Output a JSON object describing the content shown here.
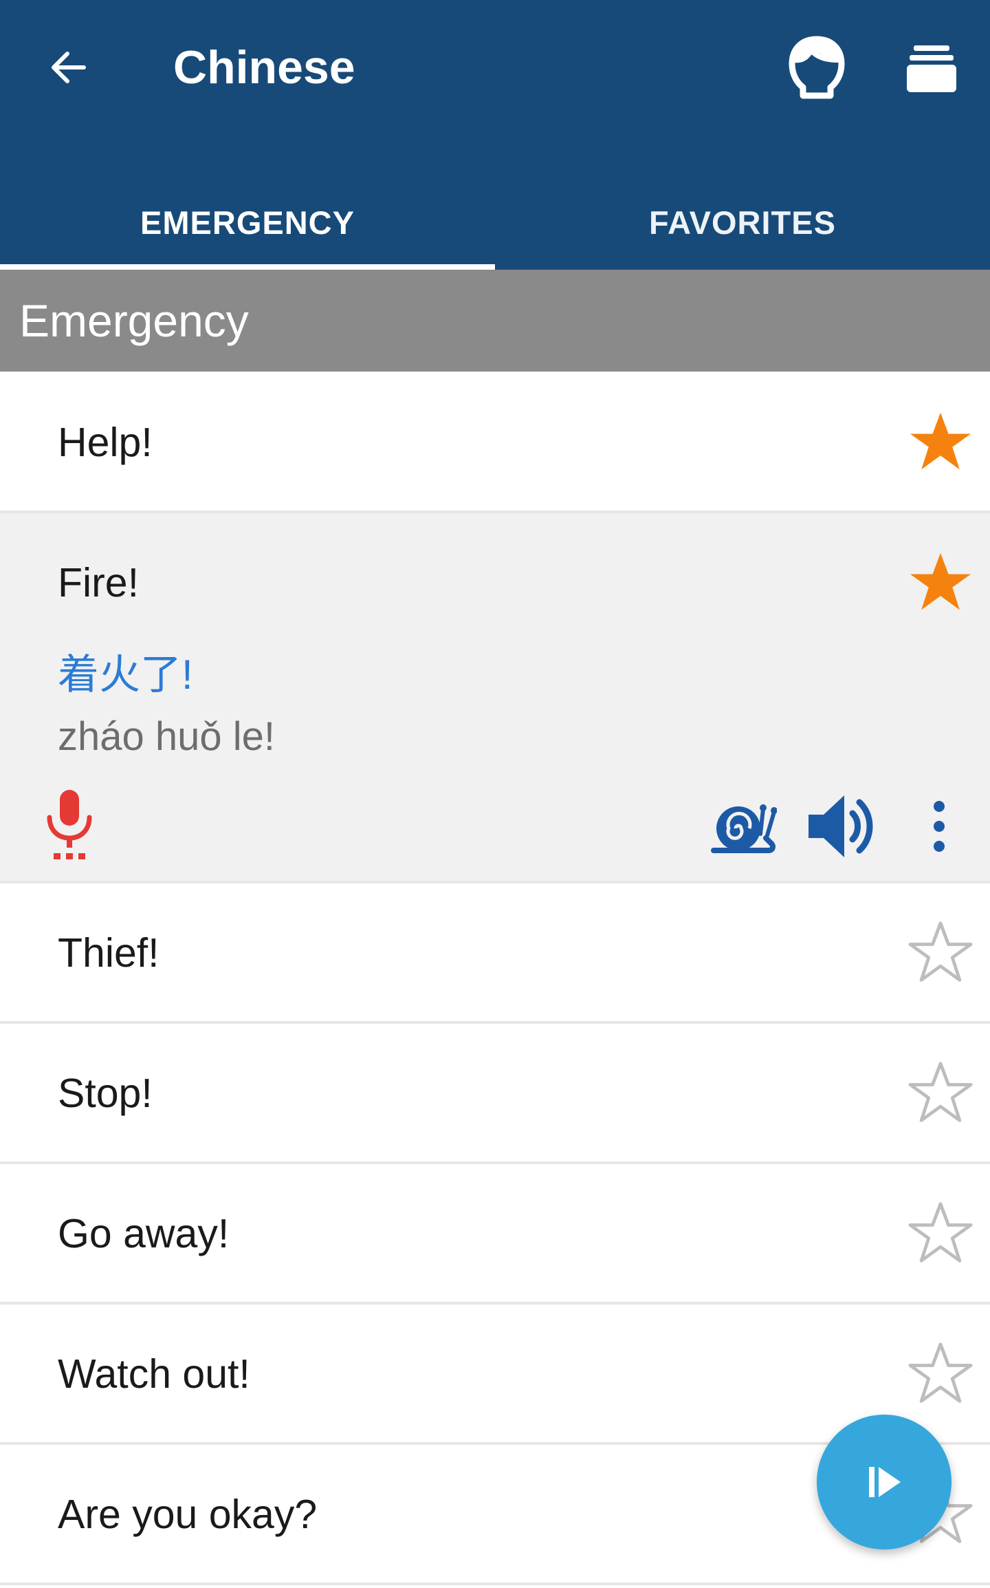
{
  "appbar": {
    "title": "Chinese",
    "back_icon": "arrow-left-icon",
    "profile_icon": "head-icon",
    "cards_icon": "card-stack-icon",
    "background": "#174a78"
  },
  "tabs": [
    {
      "label": "EMERGENCY",
      "selected": true
    },
    {
      "label": "FAVORITES",
      "selected": false
    }
  ],
  "section": {
    "title": "Emergency"
  },
  "phrases": [
    {
      "label": "Help!",
      "favorite": true
    },
    {
      "label": "Fire!",
      "favorite": true,
      "expanded": true,
      "translation": "着火了!",
      "pinyin": "zháo huǒ le!"
    },
    {
      "label": "Thief!",
      "favorite": false
    },
    {
      "label": "Stop!",
      "favorite": false
    },
    {
      "label": "Go away!",
      "favorite": false
    },
    {
      "label": "Watch out!",
      "favorite": false
    },
    {
      "label": "Are you okay?",
      "favorite": false
    }
  ],
  "expanded_actions": {
    "record_icon": "microphone-icon",
    "slow_icon": "snail-icon",
    "speak_icon": "speaker-icon",
    "more_icon": "more-vert-icon"
  },
  "fab": {
    "icon": "play-icon",
    "color": "#35a7dc"
  },
  "colors": {
    "favorite_star": "#f5820f",
    "empty_star": "#bdbdbd",
    "translation": "#2c7bd6",
    "mic": "#e53935",
    "action_blue": "#1d5aa6"
  }
}
